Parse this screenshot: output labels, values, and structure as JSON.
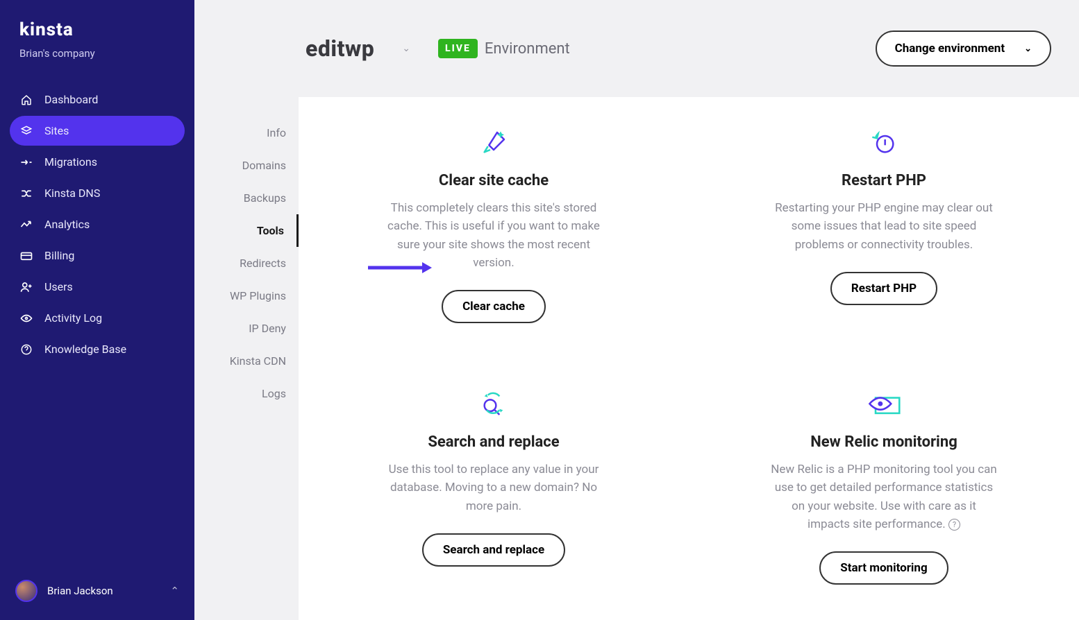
{
  "brand": "kinsta",
  "company": "Brian's company",
  "nav": [
    {
      "label": "Dashboard"
    },
    {
      "label": "Sites"
    },
    {
      "label": "Migrations"
    },
    {
      "label": "Kinsta DNS"
    },
    {
      "label": "Analytics"
    },
    {
      "label": "Billing"
    },
    {
      "label": "Users"
    },
    {
      "label": "Activity Log"
    },
    {
      "label": "Knowledge Base"
    }
  ],
  "user": {
    "name": "Brian Jackson"
  },
  "site": {
    "name": "editwp",
    "env_badge": "LIVE",
    "env_label": "Environment",
    "change_env": "Change environment"
  },
  "subnav": [
    "Info",
    "Domains",
    "Backups",
    "Tools",
    "Redirects",
    "WP Plugins",
    "IP Deny",
    "Kinsta CDN",
    "Logs"
  ],
  "tools": {
    "clear_cache": {
      "title": "Clear site cache",
      "desc": "This completely clears this site's stored cache. This is useful if you want to make sure your site shows the most recent version.",
      "button": "Clear cache"
    },
    "restart_php": {
      "title": "Restart PHP",
      "desc": "Restarting your PHP engine may clear out some issues that lead to site speed problems or connectivity troubles.",
      "button": "Restart PHP"
    },
    "search_replace": {
      "title": "Search and replace",
      "desc": "Use this tool to replace any value in your database. Moving to a new domain? No more pain.",
      "button": "Search and replace"
    },
    "new_relic": {
      "title": "New Relic monitoring",
      "desc": "New Relic is a PHP monitoring tool you can use to get detailed performance statistics on your website. Use with care as it impacts site performance. ",
      "button": "Start monitoring"
    }
  }
}
